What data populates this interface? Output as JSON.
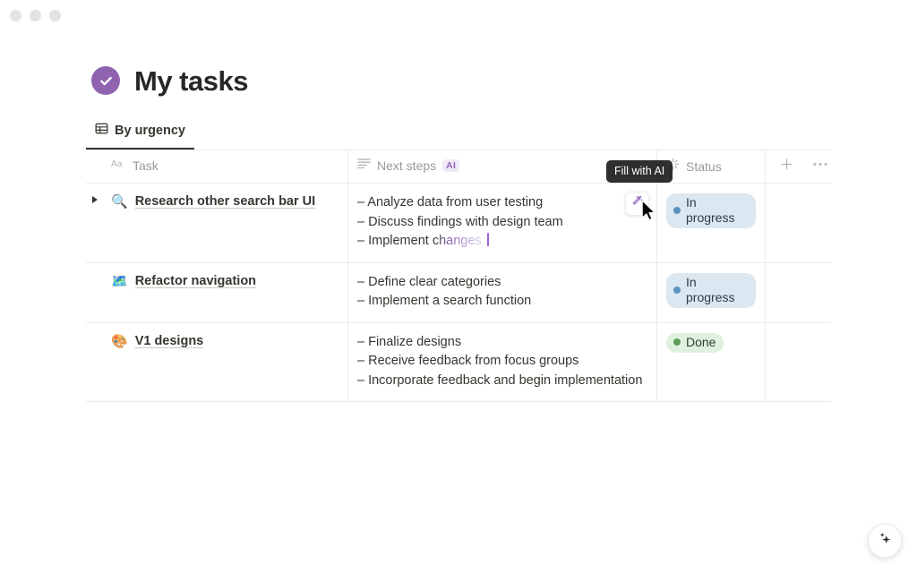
{
  "window": {
    "dots": [
      "traffic-dot-1",
      "traffic-dot-2",
      "traffic-dot-3"
    ]
  },
  "header": {
    "icon": "check-circle-icon",
    "title": "My tasks",
    "badge_color": "#9063b0"
  },
  "tabs": [
    {
      "label": "By urgency",
      "icon": "table-icon",
      "active": true
    }
  ],
  "table": {
    "columns": [
      {
        "label": "Task",
        "icon": "title-aa-icon",
        "ai": false
      },
      {
        "label": "Next steps",
        "icon": "text-lines-icon",
        "ai": true,
        "ai_badge": "AI"
      },
      {
        "label": "Status",
        "icon": "select-icon",
        "ai": false
      }
    ],
    "header_actions": [
      {
        "name": "add-column-button",
        "icon": "plus-icon"
      },
      {
        "name": "more-options-button",
        "icon": "ellipsis-icon"
      }
    ],
    "rows": [
      {
        "emoji": "🔍",
        "emoji_name": "magnifying-glass-emoji",
        "task": "Research other search bar UI",
        "expandable": true,
        "steps": [
          {
            "text": "– Analyze data from user testing",
            "typing": false
          },
          {
            "text": "– Discuss findings with design team",
            "typing": false
          },
          {
            "prefix": "– Implement ",
            "typing_text": "changes",
            "typing": true,
            "caret": true
          }
        ],
        "status": {
          "label": "In progress",
          "style": "inprogress"
        },
        "ai_fill_button": {
          "name": "fill-with-ai-button",
          "icon": "magic-wand-icon"
        }
      },
      {
        "emoji": "🗺️",
        "emoji_name": "map-emoji",
        "task": "Refactor navigation",
        "expandable": false,
        "steps": [
          {
            "text": "– Define clear categories",
            "typing": false
          },
          {
            "text": "– Implement a search function",
            "typing": false
          }
        ],
        "status": {
          "label": "In progress",
          "style": "inprogress"
        }
      },
      {
        "emoji": "🎨",
        "emoji_name": "palette-emoji",
        "task": "V1 designs",
        "expandable": false,
        "steps": [
          {
            "text": "– Finalize designs",
            "typing": false
          },
          {
            "text": "– Receive feedback from focus groups",
            "typing": false
          },
          {
            "text": "– Incorporate feedback and begin implementation",
            "typing": false
          }
        ],
        "status": {
          "label": "Done",
          "style": "done"
        }
      }
    ]
  },
  "tooltip": {
    "text": "Fill with AI"
  },
  "fab": {
    "name": "ai-assistant-button",
    "icon": "sparkles-icon"
  },
  "colors": {
    "accent_purple": "#9063b0",
    "ai_purple": "#9165ba",
    "caret_purple": "#9a63d8",
    "status_blue_bg": "#dbe8f1",
    "status_blue_dot": "#5b92c0",
    "status_green_bg": "#dff0de",
    "status_green_dot": "#5e9c5a",
    "tooltip_bg": "#2f2f2f"
  }
}
